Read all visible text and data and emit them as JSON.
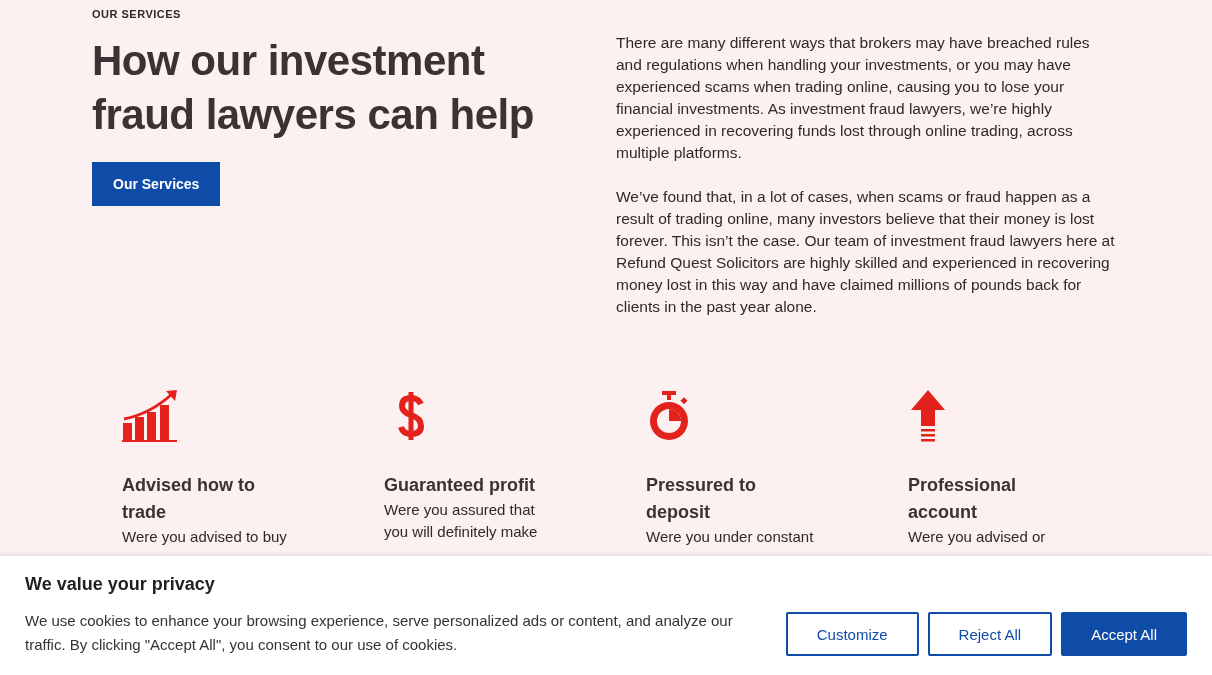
{
  "section": {
    "eyebrow": "OUR SERVICES",
    "heading": "How our investment fraud lawyers can help",
    "button": "Our Services",
    "paragraphs": [
      "There are many different ways that brokers may have breached rules and regulations when handling your investments, or you may have experienced scams when trading online, causing you to lose your financial investments. As investment fraud lawyers, we’re highly experienced in recovering funds lost through online trading, across multiple platforms.",
      "We’ve found that, in a lot of cases, when scams or fraud happen as a result of trading online, many investors believe that their money is lost forever. This isn’t the case. Our team of investment fraud lawyers here at Refund Quest Solicitors are highly skilled and experienced in recovering money lost in this way and have claimed millions of pounds back for clients in the past year alone."
    ]
  },
  "cards": [
    {
      "kind": "chart",
      "title": "Advised how to trade",
      "text": "Were you advised to buy"
    },
    {
      "kind": "dollar",
      "title": "Guaranteed profit",
      "text": "Were you assured that you will definitely make"
    },
    {
      "kind": "stopwatch",
      "title": "Pressured to deposit",
      "text": "Were you under constant"
    },
    {
      "kind": "arrow",
      "title": "Professional account",
      "text": "Were you advised or"
    }
  ],
  "cookie_banner": {
    "title": "We value your privacy",
    "text": "We use cookies to enhance your browsing experience, serve personalized ads or content, and analyze our traffic. By clicking \"Accept All\", you consent to our use of cookies.",
    "buttons": [
      {
        "label": "Customize",
        "kind": "outline"
      },
      {
        "label": "Reject All",
        "kind": "outline"
      },
      {
        "label": "Accept All",
        "kind": "primary"
      }
    ]
  }
}
